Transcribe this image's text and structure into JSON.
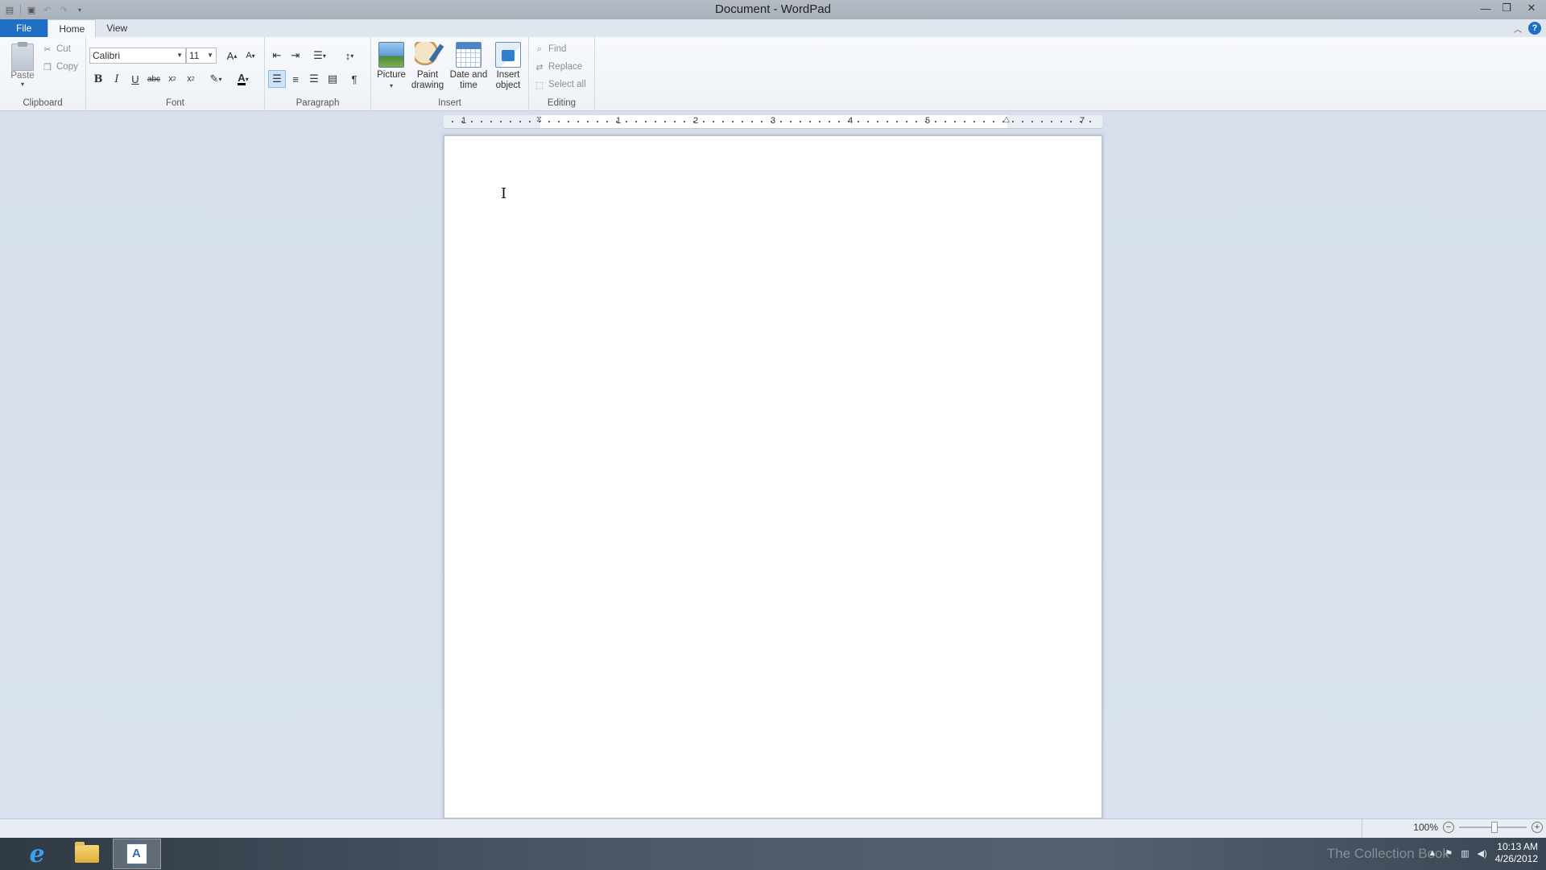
{
  "window": {
    "title": "Document - WordPad"
  },
  "tabs": [
    {
      "label": "File"
    },
    {
      "label": "Home"
    },
    {
      "label": "View"
    }
  ],
  "ribbon": {
    "clipboard": {
      "label": "Clipboard",
      "paste": "Paste",
      "cut": "Cut",
      "copy": "Copy"
    },
    "font": {
      "label": "Font",
      "family": "Calibri",
      "size": "11"
    },
    "paragraph": {
      "label": "Paragraph"
    },
    "insert": {
      "label": "Insert",
      "picture": "Picture",
      "paint_line1": "Paint",
      "paint_line2": "drawing",
      "date_line1": "Date and",
      "date_line2": "time",
      "object_line1": "Insert",
      "object_line2": "object"
    },
    "editing": {
      "label": "Editing",
      "find": "Find",
      "replace": "Replace",
      "select_all": "Select all"
    }
  },
  "ruler": {
    "numbers": [
      "1",
      "1",
      "2",
      "3",
      "4",
      "5",
      "7"
    ]
  },
  "status": {
    "zoom": "100%"
  },
  "taskbar": {
    "time": "10:13 AM",
    "date": "4/26/2012",
    "watermark": "The Collection Book"
  }
}
